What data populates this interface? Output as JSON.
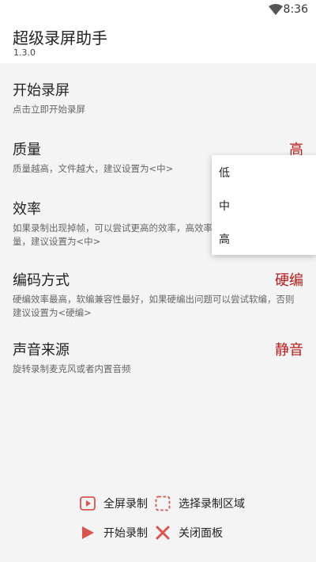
{
  "status_bar": {
    "time": "8:36",
    "wifi_icon": "wifi-icon",
    "battery_icon": "battery-icon"
  },
  "app": {
    "title": "超级录屏助手",
    "version": "1.3.0"
  },
  "sections": {
    "start": {
      "title": "开始录屏",
      "desc": "点击立即开始录屏"
    },
    "quality": {
      "title": "质量",
      "value": "高",
      "desc": "质量越高，文件越大，建议设置为<中>"
    },
    "efficiency": {
      "title": "效率",
      "desc": "如果录制出现掉帧，可以尝试更高的效率，高效率同时也会降低视频质量，建议设置为<中>"
    },
    "encoding": {
      "title": "编码方式",
      "value": "硬编",
      "desc": "硬编效率最高，软编兼容性最好，如果硬编出问题可以尝试软编，否则建议设置为<硬编>"
    },
    "audio": {
      "title": "声音来源",
      "value": "静音",
      "desc": "旋转录制麦克风或者内置音频"
    }
  },
  "dropdown": {
    "options": [
      "低",
      "中",
      "高"
    ]
  },
  "bottom": {
    "fullscreen": "全屏录制",
    "select_area": "选择录制区域",
    "start_record": "开始录制",
    "close_panel": "关闭面板"
  },
  "colors": {
    "accent": "#b71c1c",
    "icon_red": "#d9534f"
  }
}
